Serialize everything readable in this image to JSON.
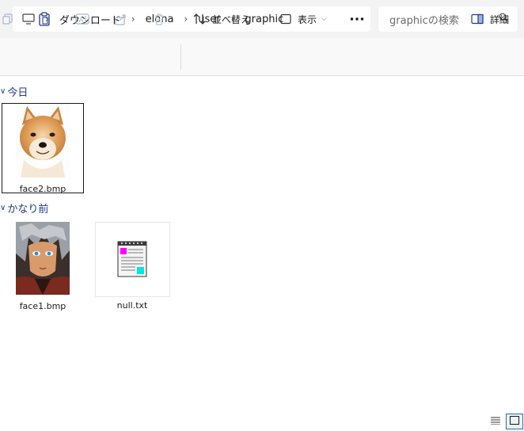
{
  "breadcrumb": {
    "items": [
      "ダウンロード",
      "elona",
      "user",
      "graphic"
    ]
  },
  "search": {
    "placeholder": "graphicの検索"
  },
  "toolbar": {
    "sort_label": "並べ替え",
    "view_label": "表示",
    "details_label": "詳細"
  },
  "groups": [
    {
      "label": "今日",
      "files": [
        {
          "name": "face2.bmp",
          "selected": true
        }
      ]
    },
    {
      "label": "かなり前",
      "files": [
        {
          "name": "face1.bmp"
        },
        {
          "name": "null.txt"
        }
      ]
    }
  ],
  "colors": {
    "accent": "#1f3a8a",
    "selection_border": "#1a1a1a"
  }
}
